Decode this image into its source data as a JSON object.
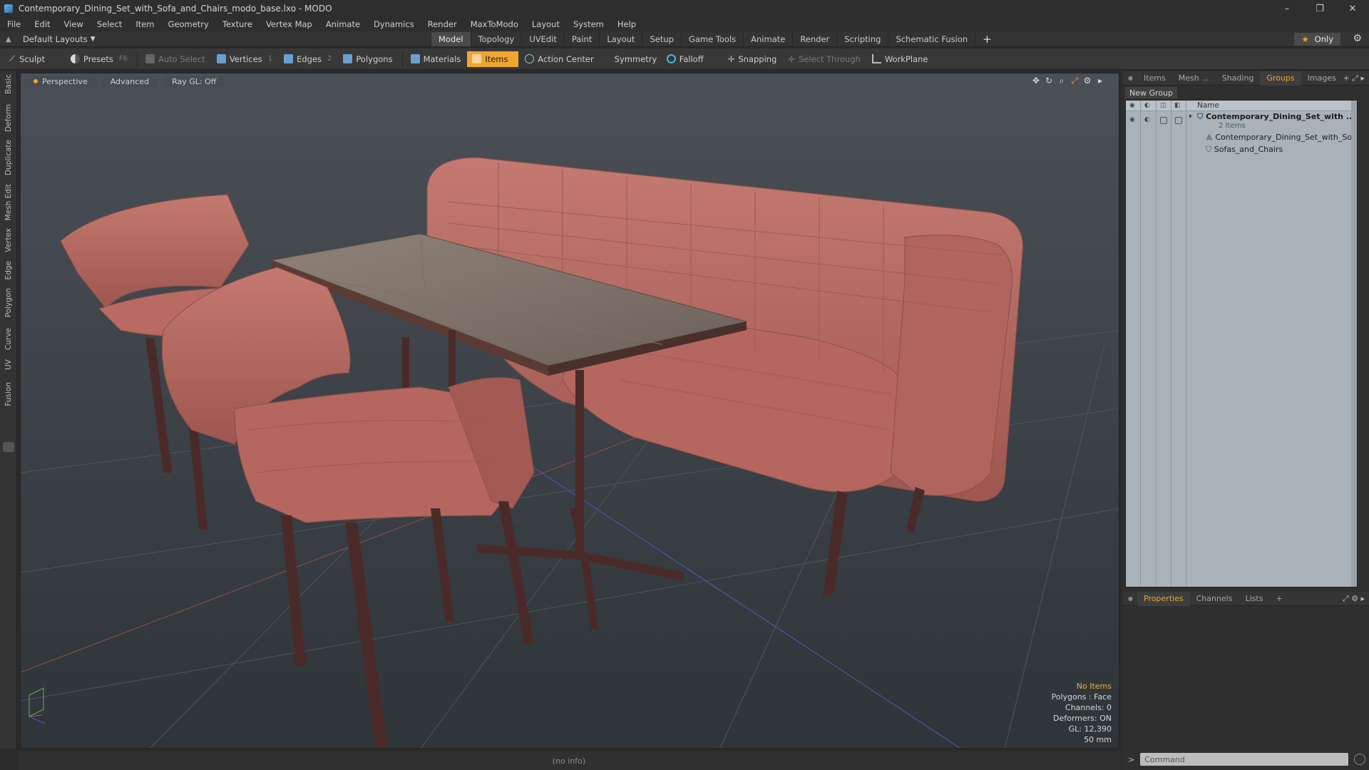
{
  "window": {
    "title": "Contemporary_Dining_Set_with_Sofa_and_Chairs_modo_base.lxo - MODO",
    "controls": [
      "–",
      "❐",
      "✕"
    ]
  },
  "menu": [
    "File",
    "Edit",
    "View",
    "Select",
    "Item",
    "Geometry",
    "Texture",
    "Vertex Map",
    "Animate",
    "Dynamics",
    "Render",
    "MaxToModo",
    "Layout",
    "System",
    "Help"
  ],
  "layout_bar": {
    "layout_select": "Default Layouts",
    "tabs": [
      {
        "label": "Model",
        "active": true
      },
      {
        "label": "Topology"
      },
      {
        "label": "UVEdit"
      },
      {
        "label": "Paint"
      },
      {
        "label": "Layout"
      },
      {
        "label": "Setup"
      },
      {
        "label": "Game Tools"
      },
      {
        "label": "Animate"
      },
      {
        "label": "Render"
      },
      {
        "label": "Scripting"
      },
      {
        "label": "Schematic Fusion"
      }
    ],
    "only_label": "Only"
  },
  "toolbar": {
    "sculpt": "Sculpt",
    "presets": "Presets",
    "presets_key": "F6",
    "auto_select": "Auto Select",
    "vertices": "Vertices",
    "vertices_key": "1",
    "edges": "Edges",
    "edges_key": "2",
    "polygons": "Polygons",
    "materials": "Materials",
    "items": "Items",
    "action_center": "Action Center",
    "symmetry": "Symmetry",
    "falloff": "Falloff",
    "snapping": "Snapping",
    "select_through": "Select Through",
    "workplane": "WorkPlane"
  },
  "left_tabs": [
    "Basic",
    "Deform",
    "Duplicate",
    "Mesh Edit",
    "Vertex",
    "Edge",
    "Polygon",
    "Curve",
    "UV",
    "Fusion"
  ],
  "viewport": {
    "view_mode": "Perspective",
    "shading": "Advanced",
    "raygl": "Ray GL: Off",
    "info": {
      "selection": "No Items",
      "polygons": "Polygons : Face",
      "channels": "Channels: 0",
      "deformers": "Deformers: ON",
      "gl": "GL: 12,390",
      "scale": "50 mm"
    }
  },
  "statusbar": {
    "text": "(no info)"
  },
  "right_panel": {
    "top_tabs": [
      {
        "label": "Items"
      },
      {
        "label": "Mesh ..."
      },
      {
        "label": "Shading"
      },
      {
        "label": "Groups",
        "active": true
      },
      {
        "label": "Images"
      }
    ],
    "new_group": "New Group",
    "column_name": "Name",
    "group": {
      "name": "Contemporary_Dining_Set_with ...",
      "count": "2 Items",
      "children": [
        "Contemporary_Dining_Set_with_So ...",
        "Sofas_and_Chairs"
      ]
    },
    "bottom_tabs": [
      {
        "label": "Properties",
        "active": true
      },
      {
        "label": "Channels"
      },
      {
        "label": "Lists"
      }
    ],
    "command_placeholder": "Command"
  },
  "colors": {
    "accent": "#f0a530",
    "upholstery": "#b86a62",
    "wood": "#4a2a28",
    "viewport_bg": "#3d444a"
  }
}
